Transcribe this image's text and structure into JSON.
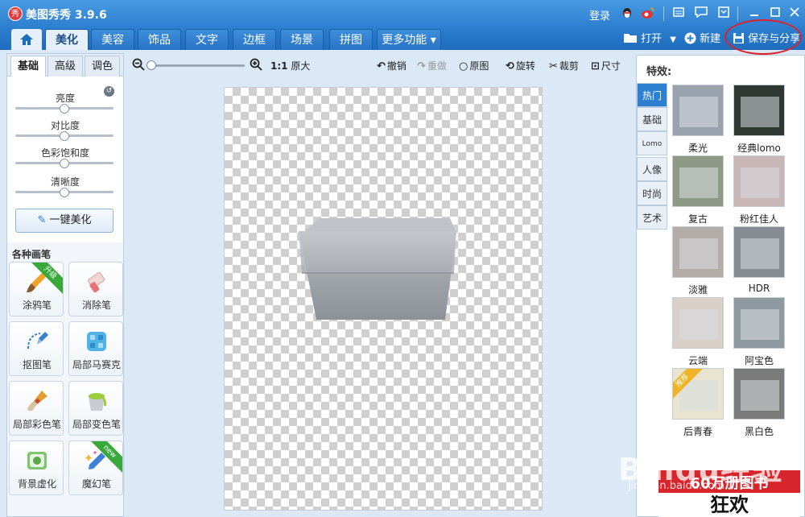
{
  "app": {
    "logo_text": "秀",
    "title": "美图秀秀 3.9.6"
  },
  "titlebar": {
    "login": "登录",
    "icons": [
      "qq-icon",
      "weibo-icon",
      "skin-icon",
      "feedback-icon",
      "menu-icon",
      "minimize-icon",
      "maximize-icon",
      "close-icon"
    ]
  },
  "tabs": {
    "home": "⌂",
    "items": [
      {
        "label": "美化",
        "active": true
      },
      {
        "label": "美容"
      },
      {
        "label": "饰品"
      },
      {
        "label": "文字"
      },
      {
        "label": "边框"
      },
      {
        "label": "场景"
      },
      {
        "label": "拼图"
      }
    ],
    "more": "更多功能 ▾"
  },
  "actions": {
    "open": "打开",
    "new": "新建",
    "save_share": "保存与分享"
  },
  "toolbar": {
    "zoom_ratio": "1:1",
    "original_size": "原大",
    "undo": "撤销",
    "redo": "重做",
    "original": "原图",
    "rotate": "旋转",
    "crop": "裁剪",
    "size": "尺寸",
    "zoom_level": 0.02
  },
  "left": {
    "sub_tabs": [
      {
        "label": "基础",
        "active": true
      },
      {
        "label": "高级"
      },
      {
        "label": "调色"
      }
    ],
    "sliders": [
      {
        "label": "亮度",
        "value": 0.5
      },
      {
        "label": "对比度",
        "value": 0.5
      },
      {
        "label": "色彩饱和度",
        "value": 0.5
      },
      {
        "label": "清晰度",
        "value": 0.5
      }
    ],
    "one_key": "一键美化",
    "pens_title": "各种画笔",
    "pens": [
      {
        "label": "涂鸦笔",
        "badge": "升级",
        "icon": "brush-icon"
      },
      {
        "label": "消除笔",
        "icon": "eraser-icon"
      },
      {
        "label": "抠图笔",
        "icon": "cutout-pen-icon"
      },
      {
        "label": "局部马赛克",
        "icon": "mosaic-icon"
      },
      {
        "label": "局部彩色笔",
        "icon": "color-brush-icon"
      },
      {
        "label": "局部变色笔",
        "icon": "paint-bucket-icon"
      },
      {
        "label": "背景虚化",
        "icon": "blur-background-icon"
      },
      {
        "label": "魔幻笔",
        "badge": "new",
        "icon": "magic-pen-icon"
      }
    ]
  },
  "right": {
    "title": "特效:",
    "categories": [
      {
        "label": "热门",
        "active": true
      },
      {
        "label": "基础"
      },
      {
        "label": "Lomo"
      },
      {
        "label": "人像"
      },
      {
        "label": "时尚"
      },
      {
        "label": "艺术"
      }
    ],
    "effects": [
      {
        "label": "柔光",
        "bg": "#9aa3ad"
      },
      {
        "label": "经典lomo",
        "bg": "#2f3830"
      },
      {
        "label": "复古",
        "bg": "#8f9a86"
      },
      {
        "label": "粉红佳人",
        "bg": "#c9b6b6"
      },
      {
        "label": "淡雅",
        "bg": "#b3aca7"
      },
      {
        "label": "HDR",
        "bg": "#868c92"
      },
      {
        "label": "云端",
        "bg": "#d8cfc8"
      },
      {
        "label": "阿宝色",
        "bg": "#8e9aa0"
      },
      {
        "label": "后青春",
        "bg": "#e8e4d0",
        "badge": "推荐"
      },
      {
        "label": "黑白色",
        "bg": "#7a7a7a"
      }
    ]
  },
  "promo": {
    "line1": "60万册图书",
    "line2": "狂欢"
  },
  "watermark": {
    "text": "Baidu经验",
    "sub": "jingyan.baidu.com"
  },
  "colors": {
    "accent": "#2d7fd0",
    "active_tab": "#e6f0fb",
    "highlight": "#d9242b"
  }
}
